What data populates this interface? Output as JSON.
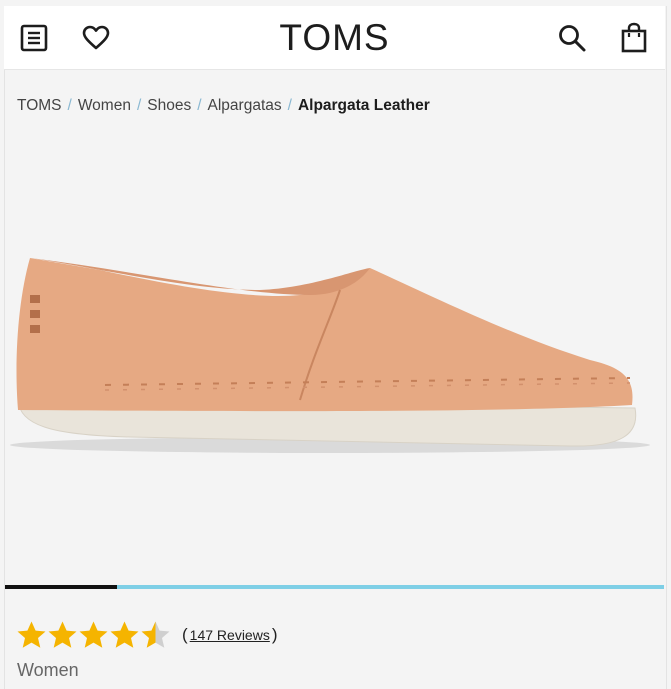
{
  "header": {
    "logo_text": "TOMS",
    "menu_icon": "menu-icon",
    "wishlist_icon": "heart-icon",
    "search_icon": "search-icon",
    "cart_icon": "shopping-bag-icon"
  },
  "breadcrumb": {
    "items": [
      "TOMS",
      "Women",
      "Shoes",
      "Alpargatas"
    ],
    "current": "Alpargata Leather"
  },
  "product": {
    "image_alt": "",
    "gallery_progress": 0.17
  },
  "rating": {
    "stars": 4.5,
    "review_count_text": "147 Reviews",
    "open_paren": "(",
    "close_paren": ")"
  },
  "category": "Women",
  "colors": {
    "star": "#f5b400",
    "progress_active": "#111111",
    "progress_track": "#7ecfe6",
    "shoe": "#e6a983",
    "sole": "#e9e4da"
  }
}
